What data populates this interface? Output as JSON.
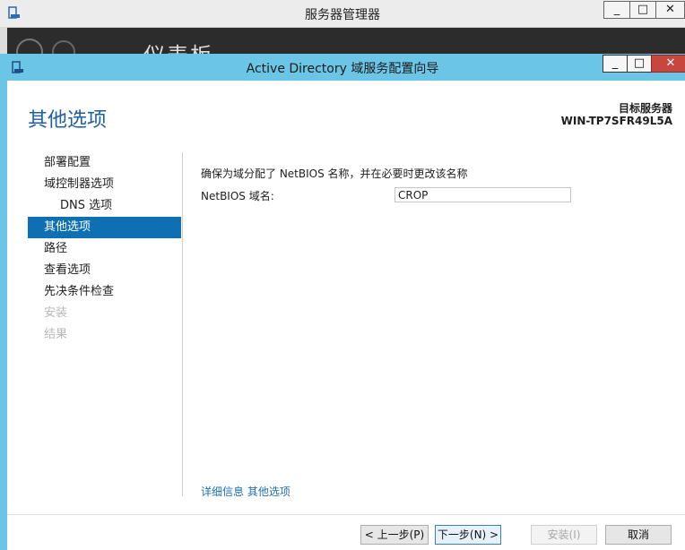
{
  "background_window": {
    "title": "服务器管理器",
    "minimize": "_",
    "maximize": "□",
    "close": "✕",
    "heading": "仪表板"
  },
  "dialog": {
    "title": "Active Directory 域服务配置向导",
    "minimize": "_",
    "maximize": "□",
    "close": "✕",
    "accent_color": "#6ac5e6"
  },
  "page": {
    "title": "其他选项",
    "target_server_label": "目标服务器",
    "target_server_name": "WIN-TP7SFR49L5A"
  },
  "nav": {
    "items": [
      {
        "label": "部署配置",
        "state": "normal"
      },
      {
        "label": "域控制器选项",
        "state": "normal"
      },
      {
        "label": "DNS 选项",
        "state": "sub"
      },
      {
        "label": "其他选项",
        "state": "active"
      },
      {
        "label": "路径",
        "state": "normal"
      },
      {
        "label": "查看选项",
        "state": "normal"
      },
      {
        "label": "先决条件检查",
        "state": "normal"
      },
      {
        "label": "安装",
        "state": "disabled"
      },
      {
        "label": "结果",
        "state": "disabled"
      }
    ]
  },
  "content": {
    "intro": "确保为域分配了 NetBIOS 名称，并在必要时更改该名称",
    "netbios_label": "NetBIOS 域名:",
    "netbios_value": "CROP",
    "more_link": "详细信息 其他选项"
  },
  "buttons": {
    "prev": "< 上一步(P)",
    "next": "下一步(N) >",
    "install": "安装(I)",
    "cancel": "取消"
  }
}
